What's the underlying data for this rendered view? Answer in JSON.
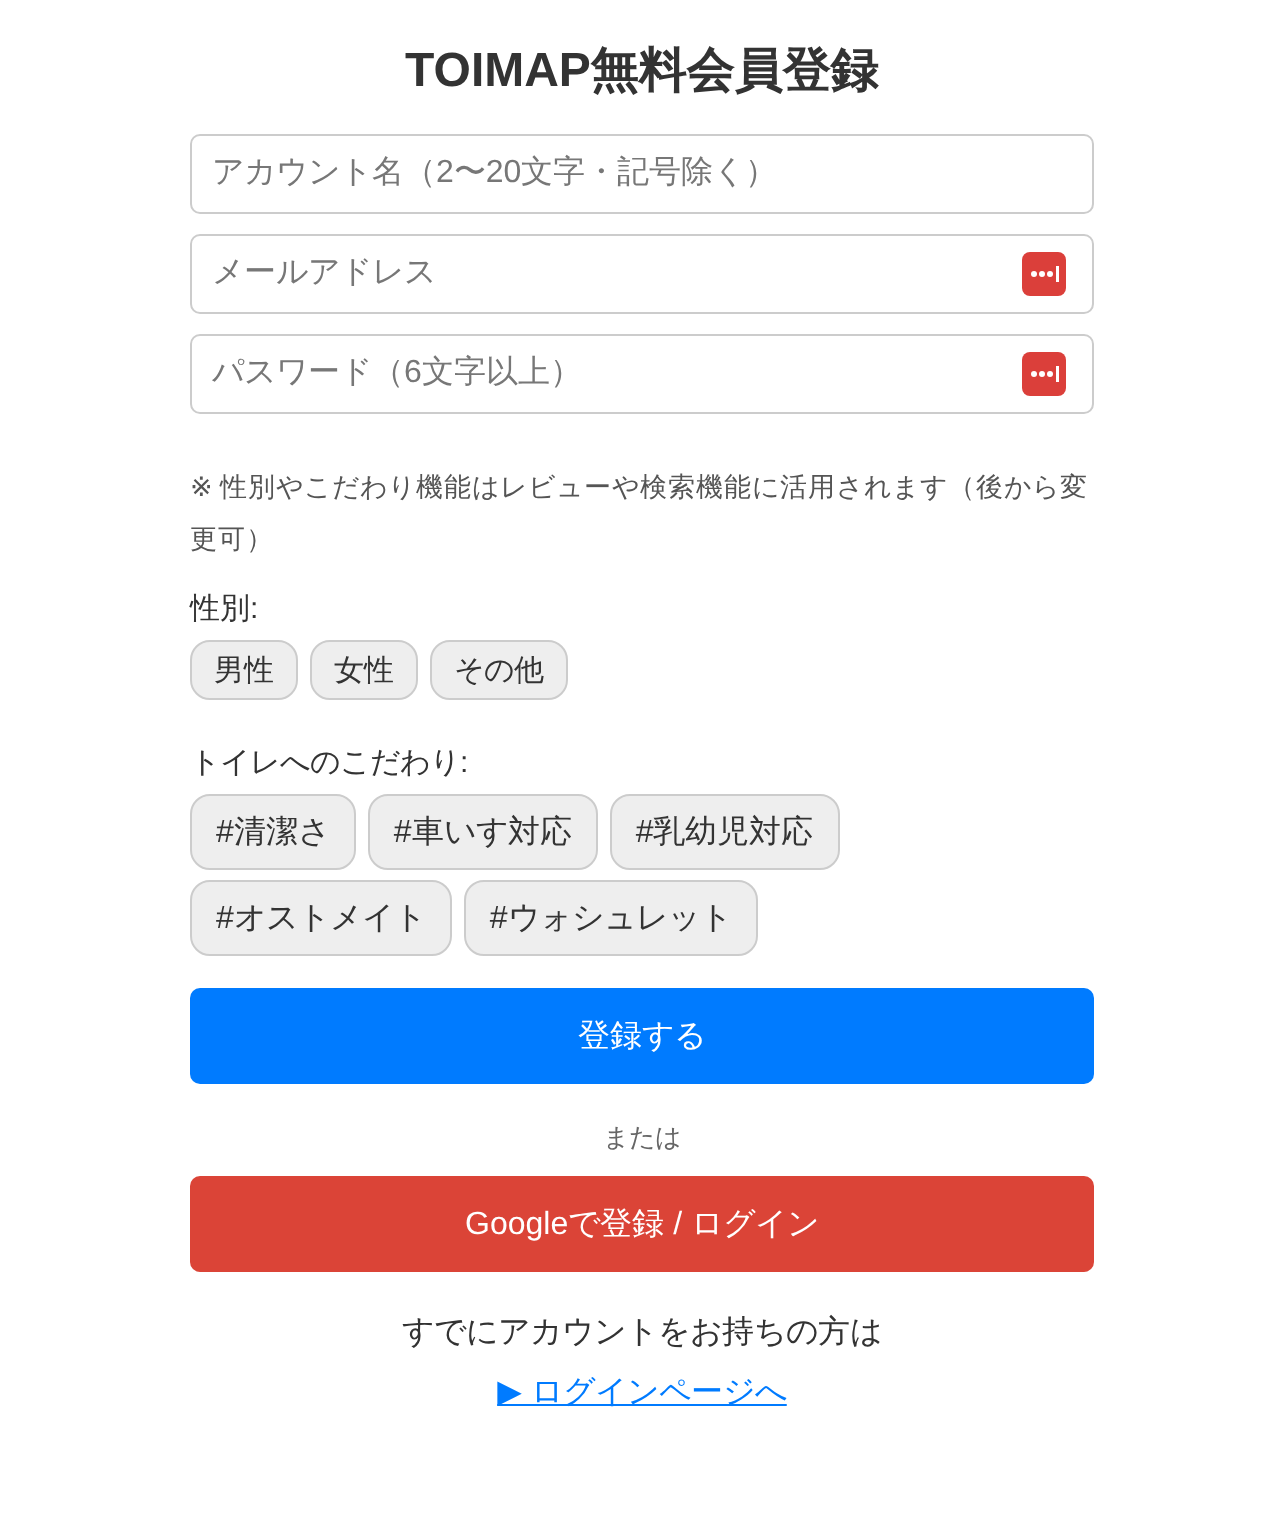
{
  "title": "TOIMAP無料会員登録",
  "fields": [
    {
      "placeholder": "アカウント名（2〜20文字・記号除く）",
      "kind": "plain"
    },
    {
      "placeholder": "メールアドレス",
      "kind": "autofill"
    },
    {
      "placeholder": "パスワード（6文字以上）",
      "kind": "autofill"
    }
  ],
  "note": "※ 性別やこだわり機能はレビューや検索機能に活用されます（後から変更可）",
  "gender": {
    "label": "性別:",
    "options": [
      {
        "label": "男性",
        "selected": false
      },
      {
        "label": "女性",
        "selected": false
      },
      {
        "label": "その他",
        "selected": false
      }
    ]
  },
  "preferences": {
    "label": "トイレへのこだわり:",
    "options": [
      {
        "label": "#清潔さ",
        "selected": false
      },
      {
        "label": "#車いす対応",
        "selected": false
      },
      {
        "label": "#乳幼児対応",
        "selected": false
      },
      {
        "label": "#オストメイト",
        "selected": false
      },
      {
        "label": "#ウォシュレット",
        "selected": false
      }
    ]
  },
  "register_button": "登録する",
  "separator": "または",
  "google_button": "Googleで登録 / ログイン",
  "login_prompt": "すでにアカウントをお持ちの方は",
  "login_link": "▶ ログインページへ"
}
